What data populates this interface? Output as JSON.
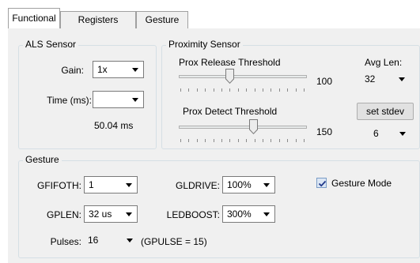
{
  "tabs": [
    {
      "label": "Functional"
    },
    {
      "label": "Registers"
    },
    {
      "label": "Gesture"
    }
  ],
  "als": {
    "title": "ALS Sensor",
    "gain_label": "Gain:",
    "gain_value": "1x",
    "time_label": "Time (ms):",
    "time_value": "",
    "time_readout": "50.04 ms"
  },
  "proximity": {
    "title": "Proximity Sensor",
    "release_label": "Prox Release Threshold",
    "release_value": "100",
    "release_level": 0.39,
    "detect_label": "Prox Detect Threshold",
    "detect_value": "150",
    "detect_level": 0.59,
    "avg_len_label": "Avg Len:",
    "avg_len_value": "32",
    "set_stdev_label": "set stdev",
    "stdev_value": "6"
  },
  "gesture": {
    "title": "Gesture",
    "gfifoth_label": "GFIFOTH:",
    "gfifoth_value": "1",
    "gldrive_label": "GLDRIVE:",
    "gldrive_value": "100%",
    "gesture_mode_label": "Gesture Mode",
    "gesture_mode_checked": true,
    "gplen_label": "GPLEN:",
    "gplen_value": "32 us",
    "ledboost_label": "LEDBOOST:",
    "ledboost_value": "300%",
    "pulses_label": "Pulses:",
    "pulses_value": "16",
    "gpulse_note": "(GPULSE = 15)"
  }
}
